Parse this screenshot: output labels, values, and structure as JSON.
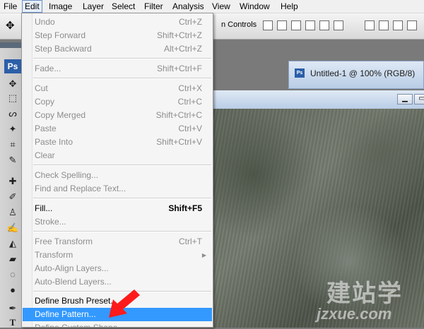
{
  "menubar": {
    "items": [
      "File",
      "Edit",
      "Image",
      "Layer",
      "Select",
      "Filter",
      "Analysis",
      "View",
      "Window",
      "Help"
    ],
    "active": "Edit"
  },
  "options_bar": {
    "controls_label": "n Controls"
  },
  "document": {
    "badge": "Ps",
    "title": "Untitled-1 @ 100% (RGB/8)"
  },
  "toolpanel": {
    "logo": "Ps"
  },
  "edit_menu": {
    "items": [
      {
        "label": "Undo",
        "shortcut": "Ctrl+Z",
        "state": "disabled"
      },
      {
        "label": "Step Forward",
        "shortcut": "Shift+Ctrl+Z",
        "state": "disabled"
      },
      {
        "label": "Step Backward",
        "shortcut": "Alt+Ctrl+Z",
        "state": "disabled"
      },
      {
        "label": "Fade...",
        "shortcut": "Shift+Ctrl+F",
        "state": "disabled"
      },
      {
        "label": "Cut",
        "shortcut": "Ctrl+X",
        "state": "disabled"
      },
      {
        "label": "Copy",
        "shortcut": "Ctrl+C",
        "state": "disabled"
      },
      {
        "label": "Copy Merged",
        "shortcut": "Shift+Ctrl+C",
        "state": "disabled"
      },
      {
        "label": "Paste",
        "shortcut": "Ctrl+V",
        "state": "disabled"
      },
      {
        "label": "Paste Into",
        "shortcut": "Shift+Ctrl+V",
        "state": "disabled"
      },
      {
        "label": "Clear",
        "shortcut": "",
        "state": "disabled"
      },
      {
        "label": "Check Spelling...",
        "shortcut": "",
        "state": "disabled"
      },
      {
        "label": "Find and Replace Text...",
        "shortcut": "",
        "state": "disabled"
      },
      {
        "label": "Fill...",
        "shortcut": "Shift+F5",
        "state": "enabled"
      },
      {
        "label": "Stroke...",
        "shortcut": "",
        "state": "disabled"
      },
      {
        "label": "Free Transform",
        "shortcut": "Ctrl+T",
        "state": "disabled"
      },
      {
        "label": "Transform",
        "shortcut": "",
        "state": "disabled"
      },
      {
        "label": "Auto-Align Layers...",
        "shortcut": "",
        "state": "disabled"
      },
      {
        "label": "Auto-Blend Layers...",
        "shortcut": "",
        "state": "disabled"
      },
      {
        "label": "Define Brush Preset...",
        "shortcut": "",
        "state": "enabled"
      },
      {
        "label": "Define Pattern...",
        "shortcut": "",
        "state": "highlighted"
      },
      {
        "label": "Define Custom Shape...",
        "shortcut": "",
        "state": "disabled"
      }
    ]
  },
  "watermark": {
    "text": "建站学",
    "url": "jzxue.com"
  },
  "colors": {
    "highlight": "#3399ff",
    "arrow": "#ff1a1a"
  }
}
